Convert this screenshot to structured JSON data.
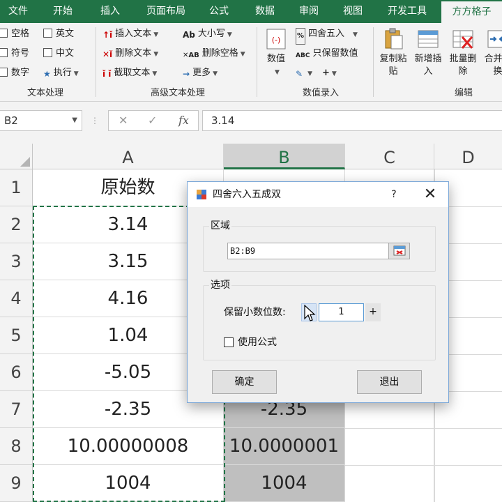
{
  "ribbon": {
    "tabs": [
      "文件",
      "开始",
      "插入",
      "页面布局",
      "公式",
      "数据",
      "审阅",
      "视图",
      "开发工具",
      "方方格子"
    ],
    "active_tab": "方方格子",
    "text_group": {
      "items": [
        "空格",
        "英文",
        "符号",
        "中文",
        "数字",
        "执行"
      ],
      "label": "文本处理"
    },
    "advanced_group": {
      "items": [
        "插入文本",
        "大小写",
        "删除文本",
        "删除空格",
        "截取文本",
        "更多"
      ],
      "label": "高级文本处理"
    },
    "numeric_group": {
      "value_button": "数值",
      "round_button": "四舍五入",
      "keep_value_button": "只保留数值",
      "label": "数值录入"
    },
    "edit_group": {
      "copy_paste": "复制粘贴",
      "insert": "新增插入",
      "batch_delete": "批量删除",
      "merge_swap": "合并转换",
      "label": "编辑"
    }
  },
  "formula_bar": {
    "name_box": "B2",
    "formula": "3.14"
  },
  "grid": {
    "columns": [
      "A",
      "B",
      "C",
      "D"
    ],
    "rows": [
      "1",
      "2",
      "3",
      "4",
      "5",
      "6",
      "7",
      "8",
      "9"
    ],
    "col_a": [
      "原始数",
      "3.14",
      "3.15",
      "4.16",
      "1.04",
      "-5.05",
      "-2.35",
      "10.00000008",
      "1004"
    ],
    "col_b_visible": [
      "-2.35",
      "10.0000001",
      "1004"
    ]
  },
  "dialog": {
    "title": "四舍六入五成双",
    "help": "?",
    "close": "✕",
    "region_legend": "区域",
    "range_value": "B2:B9",
    "options_legend": "选项",
    "decimal_label": "保留小数位数:",
    "decimal_value": "1",
    "spin_plus": "+",
    "use_formula_label": "使用公式",
    "use_formula_checked": false,
    "ok_button": "确定",
    "exit_button": "退出"
  },
  "colors": {
    "accent": "#217346",
    "selection": "#bfbfbf"
  }
}
